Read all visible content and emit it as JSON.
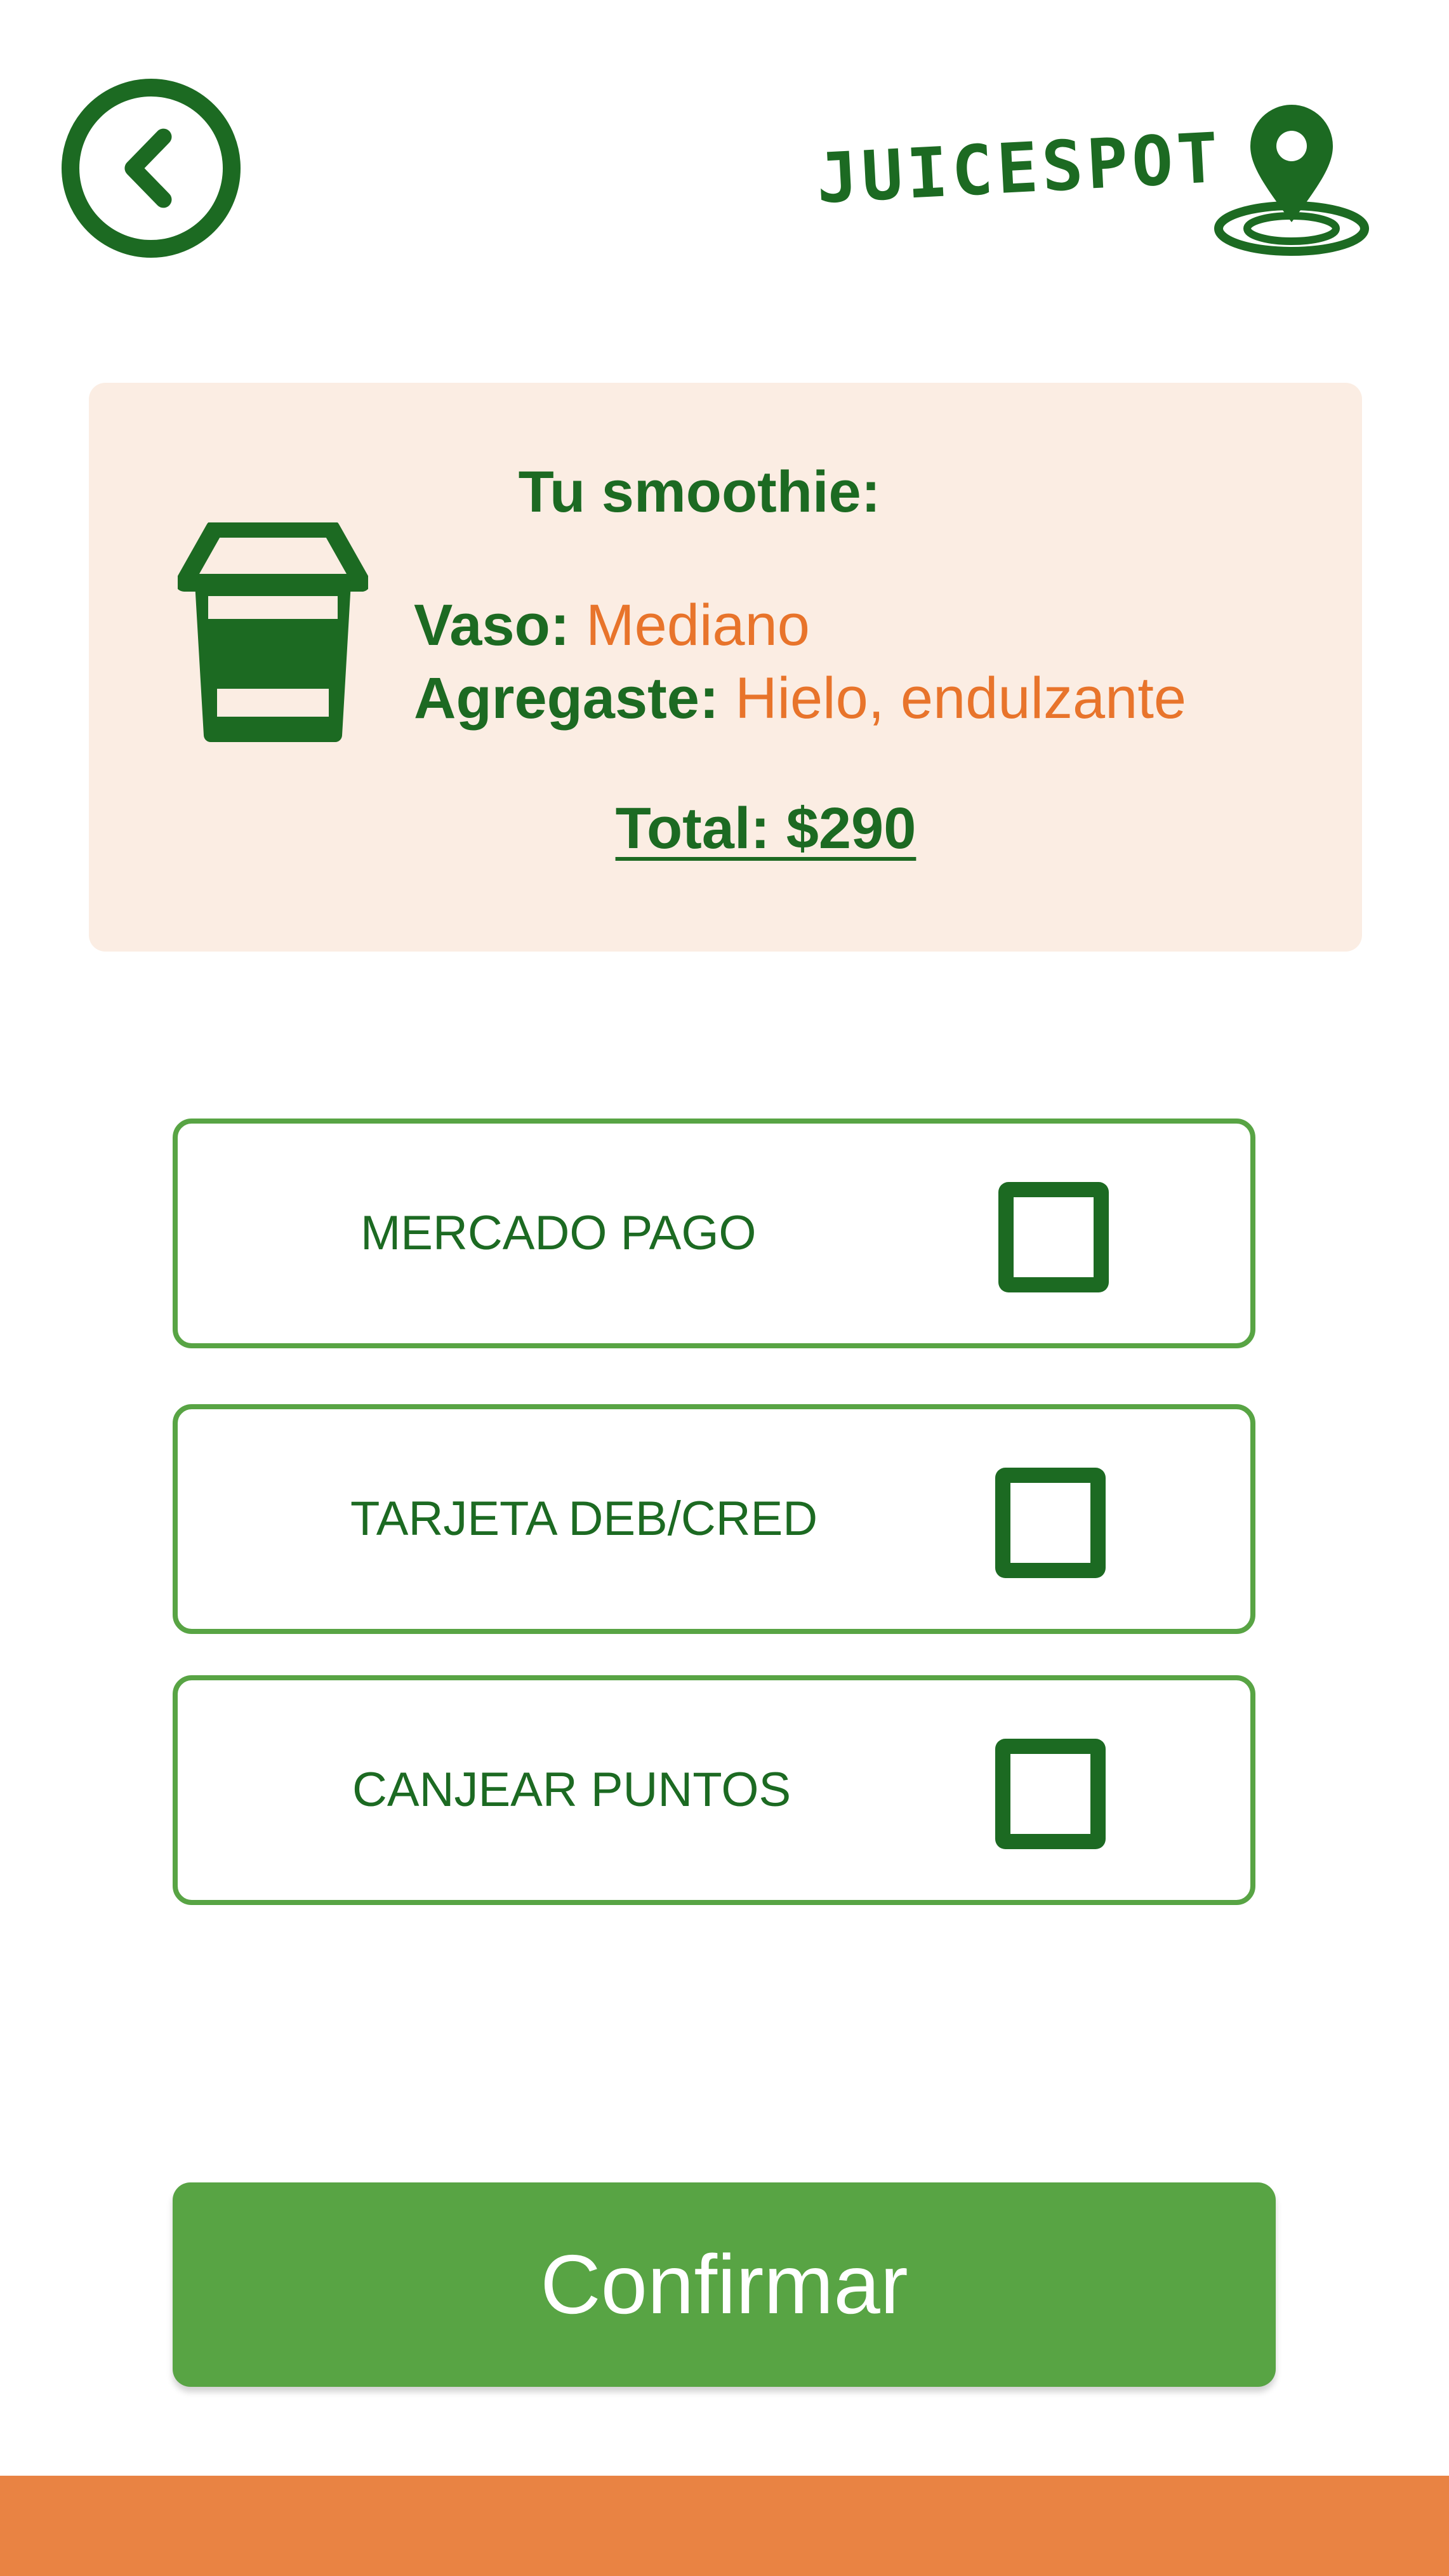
{
  "app": {
    "logo_text": "JUICESPOT"
  },
  "colors": {
    "primary_green": "#1c6a22",
    "accent_green": "#58a444",
    "accent_orange": "#e8742b",
    "card_bg": "#fbede3",
    "bottom_bar": "#e98343"
  },
  "header": {
    "back_icon": "chevron-left-icon",
    "logo_icon": "map-pin-icon"
  },
  "summary": {
    "title": "Tu smoothie:",
    "icon": "coffee-cup-icon",
    "vaso_label": "Vaso:",
    "vaso_value": "Mediano",
    "extras_label": "Agregaste:",
    "extras_value": "Hielo, endulzante",
    "total": "Total: $290"
  },
  "payment_options": [
    {
      "label": "MERCADO PAGO",
      "checked": false
    },
    {
      "label": "TARJETA DEB/CRED",
      "checked": false
    },
    {
      "label": "CANJEAR PUNTOS",
      "checked": false
    }
  ],
  "confirm_label": "Confirmar"
}
